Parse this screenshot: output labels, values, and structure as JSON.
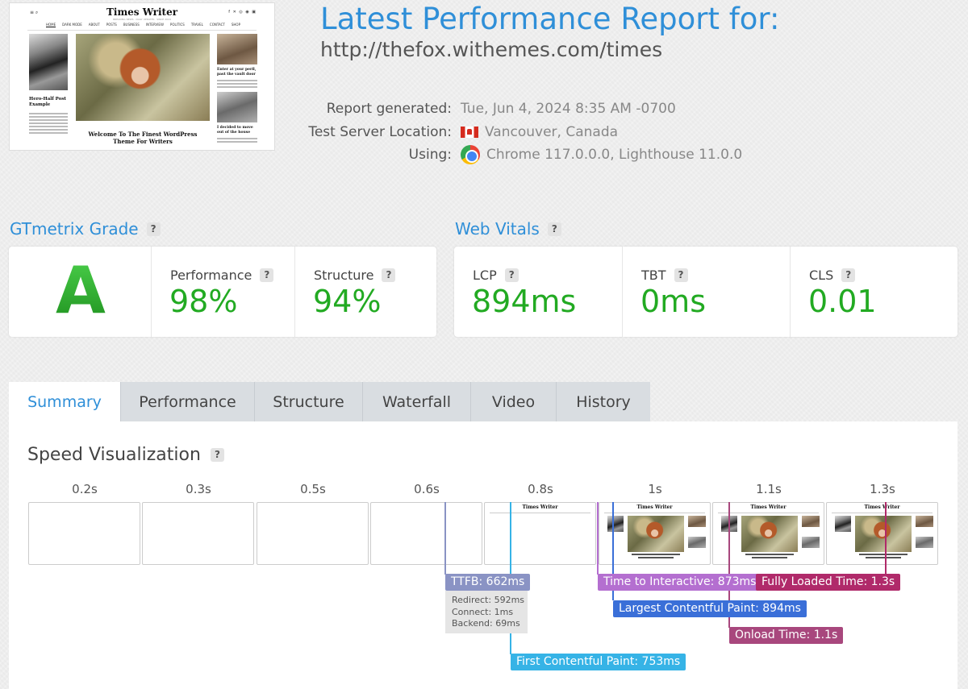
{
  "thumbnail": {
    "site_title": "Times Writer",
    "tagline": "BREAKING NEWS · DAILY UPDATES · SINCE 2024",
    "nav": [
      "HOME",
      "DARK MODE",
      "ABOUT",
      "POSTS",
      "BUSINESS",
      "INTERVIEW",
      "POLITICS",
      "TRAVEL",
      "CONTACT",
      "SHOP"
    ],
    "left_post_title": "Hero-Half Post Example",
    "hero_headline": "Welcome To The Finest WordPress Theme For Writers",
    "right_post_1": "Enter at your peril, past the vault door",
    "right_post_2": "I decided to move out of the house"
  },
  "header": {
    "heading": "Latest Performance Report for:",
    "url": "http://thefox.withemes.com/times",
    "report_generated_label": "Report generated:",
    "report_generated_value": "Tue, Jun 4, 2024 8:35 AM -0700",
    "server_location_label": "Test Server Location:",
    "server_location_value": "Vancouver, Canada",
    "using_label": "Using:",
    "using_value": "Chrome 117.0.0.0, Lighthouse 11.0.0"
  },
  "grade": {
    "title": "GTmetrix Grade",
    "letter": "A",
    "performance_label": "Performance",
    "performance_value": "98%",
    "structure_label": "Structure",
    "structure_value": "94%"
  },
  "web_vitals": {
    "title": "Web Vitals",
    "lcp_label": "LCP",
    "lcp_value": "894ms",
    "tbt_label": "TBT",
    "tbt_value": "0ms",
    "cls_label": "CLS",
    "cls_value": "0.01"
  },
  "help_glyph": "?",
  "tabs": [
    "Summary",
    "Performance",
    "Structure",
    "Waterfall",
    "Video",
    "History"
  ],
  "active_tab": "Summary",
  "speed": {
    "title": "Speed Visualization",
    "time_labels": [
      "0.2s",
      "0.3s",
      "0.5s",
      "0.6s",
      "0.8s",
      "1s",
      "1.1s",
      "1.3s"
    ],
    "frame_title": "Times Writer",
    "markers": {
      "ttfb": "TTFB: 662ms",
      "redirect": "Redirect: 592ms",
      "connect": "Connect: 1ms",
      "backend": "Backend: 69ms",
      "fcp": "First Contentful Paint: 753ms",
      "tti": "Time to Interactive: 873ms",
      "lcp": "Largest Contentful Paint: 894ms",
      "onload": "Onload Time: 1.1s",
      "fully_loaded": "Fully Loaded Time: 1.3s"
    }
  },
  "colors": {
    "accent": "#2f8fd8",
    "grade_green": "#22aa22",
    "ttfb": "#8a93c4",
    "fcp": "#36b3e6",
    "tti": "#b46fd0",
    "lcp": "#3a6fd8",
    "onload": "#a8477d",
    "fully_loaded": "#b02a6a"
  }
}
